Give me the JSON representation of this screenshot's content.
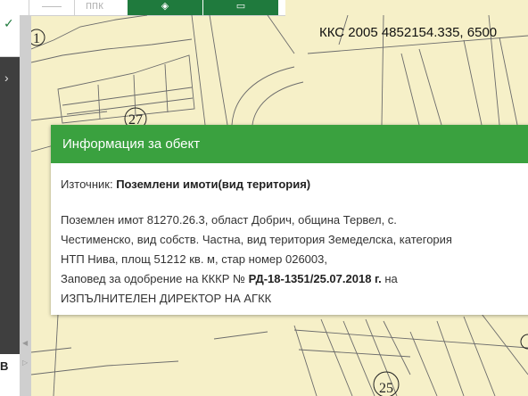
{
  "toolbar": {
    "partial_text": "ппк",
    "colors": {
      "green": "#1f7a3d",
      "panel": "#3f3f3f"
    }
  },
  "map": {
    "coords": "ККС 2005 4852154.335, 6500",
    "parcel_labels": [
      "1",
      "27",
      "25"
    ],
    "colors": {
      "background": "#f6f0c8",
      "lines": "#6b6b6b"
    }
  },
  "left_panel": {
    "label_b": "В"
  },
  "popup": {
    "title": "Информация за обект",
    "source_label": "Източник: ",
    "source_value": "Поземлени имоти(вид територия)",
    "line1": "Поземлен имот 81270.26.3, област Добрич, община Тервел, с.",
    "line2": "Честименско, вид собств. Частна, вид територия Земеделска, категория",
    "line3": "НТП Нива, площ 51212 кв. м, стар номер 026003,",
    "line4_prefix": "Заповед за одобрение на КККР № ",
    "line4_bold": "РД-18-1351/25.07.2018 г.",
    "line4_suffix": " на",
    "line5": "ИЗПЪЛНИТЕЛЕН ДИРЕКТОР НА АГКК",
    "header_color": "#3aa13f"
  }
}
